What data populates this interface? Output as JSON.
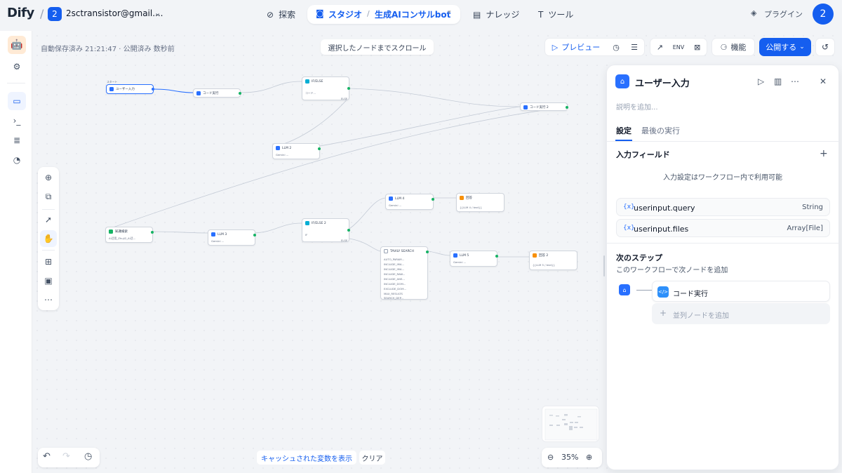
{
  "header": {
    "logo": "Dify",
    "workspace_badge": "2",
    "workspace_name": "2sctransistor@gmail....",
    "nav_explore": "探索",
    "nav_studio": "スタジオ",
    "app_name": "生成AIコンサルbot",
    "nav_knowledge": "ナレッジ",
    "nav_tools": "ツール",
    "plugins": "プラグイン",
    "avatar": "2",
    "accent_color": "#155eef"
  },
  "canvas": {
    "autosave": "自動保存済み 21:21:47 · 公開済み 数秒前",
    "scroll_to_node": "選択したノードまでスクロール",
    "preview": "プレビュー",
    "features": "機能",
    "publish": "公開する",
    "cached_vars": "キャッシュされた変数を表示",
    "clear": "クリア",
    "zoom": "35%"
  },
  "nodes": {
    "start": {
      "title": "ユーザー入力",
      "tag": "スタート"
    },
    "code1": {
      "title": "コード実行"
    },
    "ifelse1": {
      "title": "IF/ELSE",
      "line1": "コード...",
      "line2": "ELSE"
    },
    "code2": {
      "title": "コード実行 2"
    },
    "llm2": {
      "title": "LLM 2",
      "model": "Gemini ..."
    },
    "kb": {
      "title": "知識検索",
      "sub": "AI活用_Zhuji2_AI活..."
    },
    "llm3": {
      "title": "LLM 3",
      "model": "Gemini ..."
    },
    "ifelse2": {
      "title": "IF/ELSE 2",
      "line1": "IF",
      "line2": "ELSE"
    },
    "llm4": {
      "title": "LLM 4",
      "model": "Gemini ..."
    },
    "answer1": {
      "title": "回答",
      "sub": "{{LLM 4 / text}}"
    },
    "tavily": {
      "title": "TAVILY SEARCH",
      "rows": [
        "AUTO_PARAM...",
        "INCLUDE_IMA...",
        "INCLUDE_IMA...",
        "INCLUDE_RAW...",
        "INCLUDE_ANS...",
        "INCLUDE_DOM...",
        "EXCLUDE_DOM...",
        "MAX_RESULTS",
        "SEARCH_DEP..."
      ]
    },
    "llm5": {
      "title": "LLM 5",
      "model": "Gemini ..."
    },
    "answer2": {
      "title": "回答 2",
      "sub": "{{LLM 5 / text}}"
    }
  },
  "panel": {
    "title": "ユーザー入力",
    "description_placeholder": "説明を追加...",
    "tab_settings": "設定",
    "tab_last_run": "最後の実行",
    "input_fields": "入力フィールド",
    "input_hint": "入力設定はワークフロー内で利用可能",
    "variables": [
      {
        "name": "userinput.query",
        "type": "String"
      },
      {
        "name": "userinput.files",
        "type": "Array[File]"
      }
    ],
    "next_step_title": "次のステップ",
    "next_step_sub": "このワークフローで次ノードを追加",
    "next_node": "コード実行",
    "add_parallel": "並列ノードを追加"
  }
}
